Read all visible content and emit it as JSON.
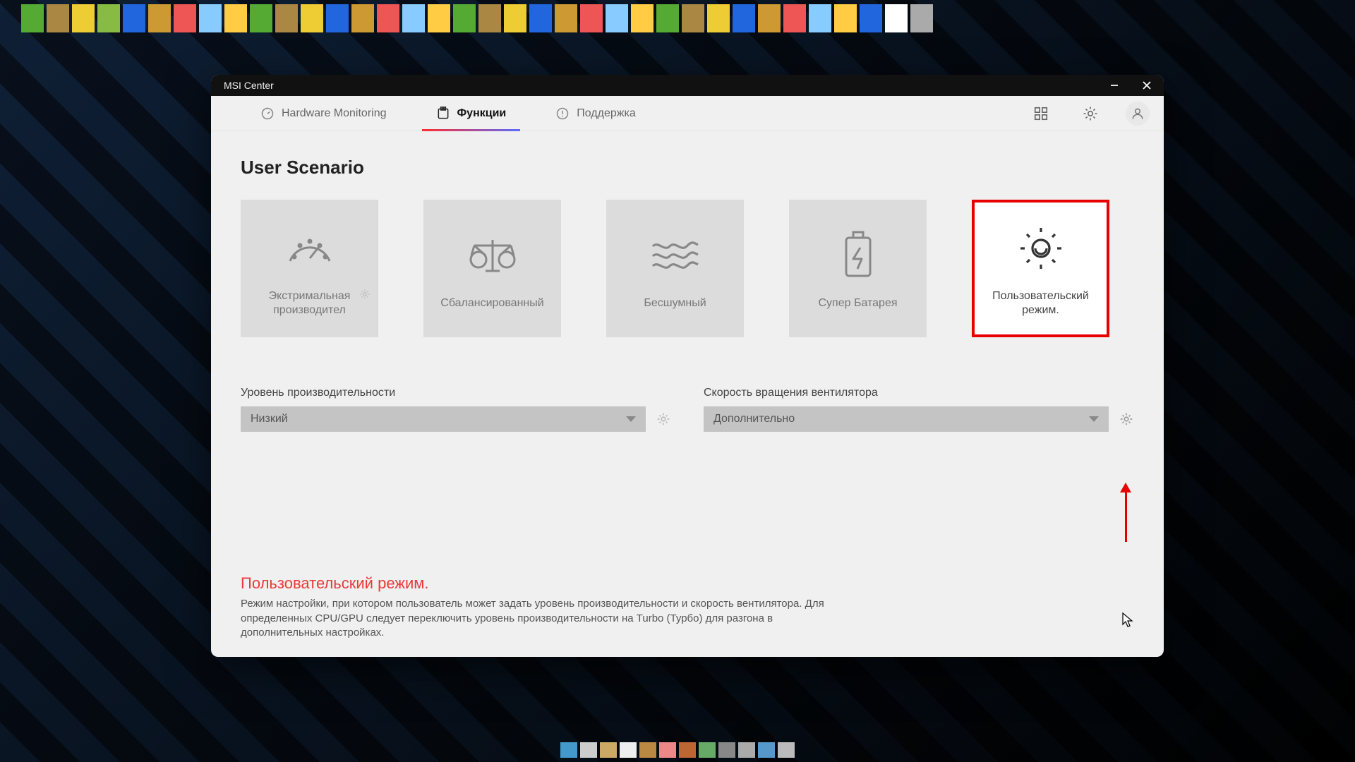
{
  "window": {
    "title": "MSI Center"
  },
  "nav": {
    "hardware": "Hardware Monitoring",
    "functions": "Функции",
    "support": "Поддержка"
  },
  "page": {
    "heading": "User Scenario"
  },
  "cards": {
    "extreme": "Экстримальная производител",
    "balanced": "Сбалансированный",
    "silent": "Бесшумный",
    "battery": "Супер Батарея",
    "custom": "Пользовательский режим."
  },
  "settings": {
    "performance": {
      "label": "Уровень производительности",
      "value": "Низкий"
    },
    "fan": {
      "label": "Скорость вращения вентилятора",
      "value": "Дополнительно"
    }
  },
  "description": {
    "title": "Пользовательский режим.",
    "body": "Режим настройки, при котором пользователь может задать уровень производительности и скорость вентилятора. Для определенных CPU/GPU следует переключить уровень производительности на Turbo (Турбо) для разгона в дополнительных настройках."
  },
  "icons": {
    "grid": "grid-icon",
    "gear": "gear-icon",
    "user": "user-icon"
  },
  "annotation": {
    "highlight_color": "#e80000"
  }
}
